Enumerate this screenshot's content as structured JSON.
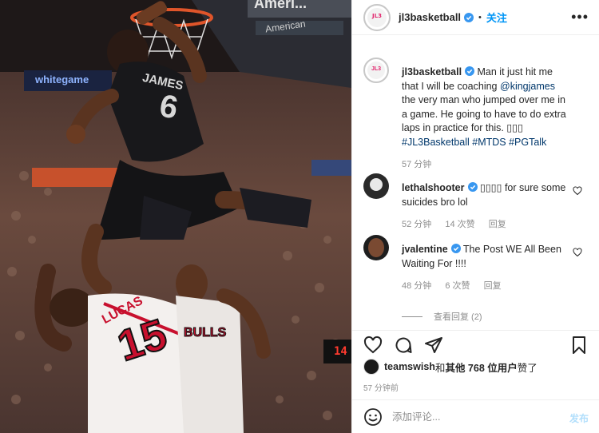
{
  "post": {
    "username": "jl3basketball",
    "follow_label": "关注",
    "separator": "•",
    "avatar_logo_text": "JL3",
    "more_icon": "more-horizontal-icon"
  },
  "photo": {
    "arena_sign_top": "Ameri...",
    "arena_sign_2": "American",
    "jersey_top_name": "JAMES",
    "jersey_top_number": "6",
    "jersey_bottom_name": "LUCAS",
    "jersey_bottom_number": "15",
    "jersey_bulls": "BULLS",
    "led_sign": "whitegame",
    "shot_clock": "14"
  },
  "caption": {
    "username": "jl3basketball",
    "text_before_tag": " Man it just hit me that I will be coaching ",
    "mention": "@kingjames",
    "text_after_tag": " the very man who jumped over me in a game. He going to have to do extra laps in practice for this. ",
    "emoji_placeholder": "▯▯▯",
    "hashtags": "#JL3Basketball #MTDS #PGTalk",
    "time": "57 分钟"
  },
  "comments": [
    {
      "username": "lethalshooter",
      "text": " ▯▯▯▯ for sure some suicides bro lol",
      "time": "52 分钟",
      "likes": "14 次赞",
      "reply": "回复"
    },
    {
      "username": "jvalentine",
      "text": " The Post WE All Been Waiting For !!!!",
      "time": "48 分钟",
      "likes": "6 次赞",
      "reply": "回复"
    }
  ],
  "view_replies": "查看回复 (2)",
  "likes_line": {
    "user": "teamswish",
    "and": " 和 ",
    "others": "其他 768 位用户",
    "suffix": " 赞了"
  },
  "time_ago": "57 分钟前",
  "add_comment": {
    "placeholder": "添加评论...",
    "post_label": "发布"
  },
  "colors": {
    "accent": "#0095f6",
    "verified": "#3897f0",
    "muted": "#8e8e8e",
    "link": "#00376b"
  }
}
